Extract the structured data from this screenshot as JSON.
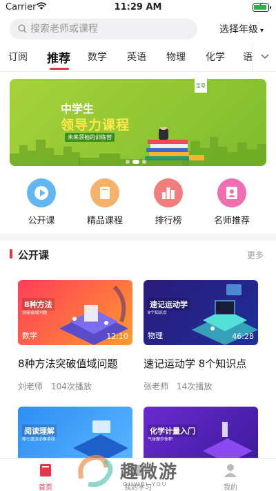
{
  "status_bar": {
    "carrier": "Carrier",
    "time": "11:29 AM",
    "battery_level": 0.95
  },
  "search": {
    "placeholder": "搜索老师或课程"
  },
  "grade_select": {
    "label": "选择年级"
  },
  "tabs": [
    {
      "label": "订阅",
      "active": false
    },
    {
      "label": "推荐",
      "active": true
    },
    {
      "label": "数学",
      "active": false
    },
    {
      "label": "英语",
      "active": false
    },
    {
      "label": "物理",
      "active": false
    },
    {
      "label": "化学",
      "active": false
    },
    {
      "label": "语",
      "active": false
    }
  ],
  "banner": {
    "subtitle": "中学生",
    "title": "领导力课程",
    "tag": "未来领袖的训练营",
    "corner_tag": "至尊",
    "page_count": 3,
    "current_page": 1
  },
  "categories": [
    {
      "label": "公开课",
      "icon": "play-icon",
      "color": "#4dabf0"
    },
    {
      "label": "精品课程",
      "icon": "book-icon",
      "color": "#f3a24a"
    },
    {
      "label": "排行榜",
      "icon": "ranking-icon",
      "color": "#f06b6b"
    },
    {
      "label": "名师推荐",
      "icon": "teacher-icon",
      "color": "#ec5fa8"
    }
  ],
  "section": {
    "title": "公开课",
    "more": "更多"
  },
  "courses": [
    {
      "thumb_label": "8种方法",
      "thumb_small": "突破值域问题",
      "subject": "数学",
      "duration": "12:10",
      "title": "8种方法突破值域问题",
      "teacher": "刘老师",
      "plays": "104次播放"
    },
    {
      "thumb_label": "速记运动学",
      "thumb_small": "8个知识点",
      "subject": "物理",
      "duration": "46:28",
      "title": "速记运动学 8个知识点",
      "teacher": "张老师",
      "plays": "14次播放"
    },
    {
      "thumb_label": "阅读理解",
      "thumb_small": "和七选五必备手段",
      "subject": "",
      "duration": "",
      "title": "",
      "teacher": "",
      "plays": ""
    },
    {
      "thumb_label": "化学计量入门",
      "thumb_small": "气体摩尔体积",
      "subject": "",
      "duration": "",
      "title": "",
      "teacher": "",
      "plays": ""
    }
  ],
  "tabbar": [
    {
      "label": "首页",
      "icon": "home-icon",
      "active": true
    },
    {
      "label": "我的学习",
      "icon": "study-icon",
      "active": false
    },
    {
      "label": "我的",
      "icon": "profile-icon",
      "active": false
    }
  ],
  "watermark": {
    "text": "趣微游",
    "sub": "QUWEI YOU"
  },
  "colors": {
    "accent": "#e2394a",
    "banner_green": "#8cc63f"
  }
}
